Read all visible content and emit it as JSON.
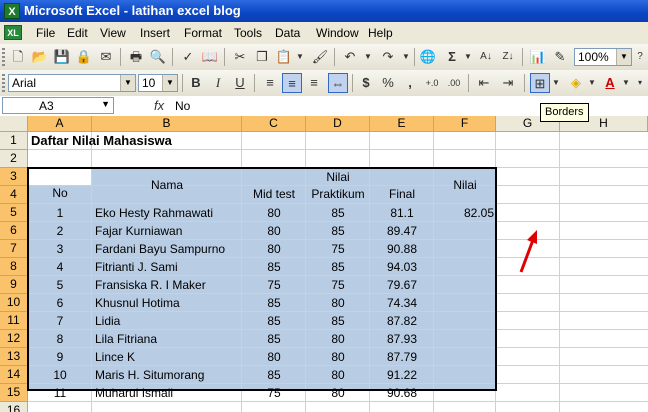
{
  "window": {
    "title": "Microsoft Excel - latihan excel blog"
  },
  "menu": [
    "File",
    "Edit",
    "View",
    "Insert",
    "Format",
    "Tools",
    "Data",
    "Window",
    "Help"
  ],
  "toolbar": {
    "zoom": "100%",
    "font": "Arial",
    "size": "10"
  },
  "formula": {
    "cell_ref": "A3",
    "fx": "fx",
    "value": "No"
  },
  "tooltip": "Borders",
  "columns": [
    "A",
    "B",
    "C",
    "D",
    "E",
    "F",
    "G",
    "H"
  ],
  "rows": [
    "1",
    "2",
    "3",
    "4",
    "5",
    "6",
    "7",
    "8",
    "9",
    "10",
    "11",
    "12",
    "13",
    "14",
    "15",
    "16"
  ],
  "sheet": {
    "title": "Daftar Nilai Mahasiswa",
    "headers": {
      "no": "No",
      "nama": "Nama",
      "nilai_group": "Nilai",
      "mid": "Mid test",
      "praktikum": "Praktikum",
      "final": "Final",
      "nilai": "Nilai"
    },
    "records": [
      {
        "no": "1",
        "nama": "Eko Hesty Rahmawati",
        "mid": "80",
        "prak": "85",
        "final": "81.1",
        "nilai": "82.05"
      },
      {
        "no": "2",
        "nama": "Fajar Kurniawan",
        "mid": "80",
        "prak": "85",
        "final": "89.47",
        "nilai": ""
      },
      {
        "no": "3",
        "nama": "Fardani Bayu Sampurno",
        "mid": "80",
        "prak": "75",
        "final": "90.88",
        "nilai": ""
      },
      {
        "no": "4",
        "nama": "Fitrianti J. Sami",
        "mid": "85",
        "prak": "85",
        "final": "94.03",
        "nilai": ""
      },
      {
        "no": "5",
        "nama": "Fransiska R. I Maker",
        "mid": "75",
        "prak": "75",
        "final": "79.67",
        "nilai": ""
      },
      {
        "no": "6",
        "nama": "Khusnul Hotima",
        "mid": "85",
        "prak": "80",
        "final": "74.34",
        "nilai": ""
      },
      {
        "no": "7",
        "nama": "Lidia",
        "mid": "85",
        "prak": "85",
        "final": "87.82",
        "nilai": ""
      },
      {
        "no": "8",
        "nama": "Lila Fitriana",
        "mid": "85",
        "prak": "80",
        "final": "87.93",
        "nilai": ""
      },
      {
        "no": "9",
        "nama": "Lince K",
        "mid": "80",
        "prak": "80",
        "final": "87.79",
        "nilai": ""
      },
      {
        "no": "10",
        "nama": "Maris H. Situmorang",
        "mid": "85",
        "prak": "80",
        "final": "91.22",
        "nilai": ""
      },
      {
        "no": "11",
        "nama": "Muharui Ismail",
        "mid": "75",
        "prak": "80",
        "final": "90.68",
        "nilai": ""
      }
    ]
  }
}
